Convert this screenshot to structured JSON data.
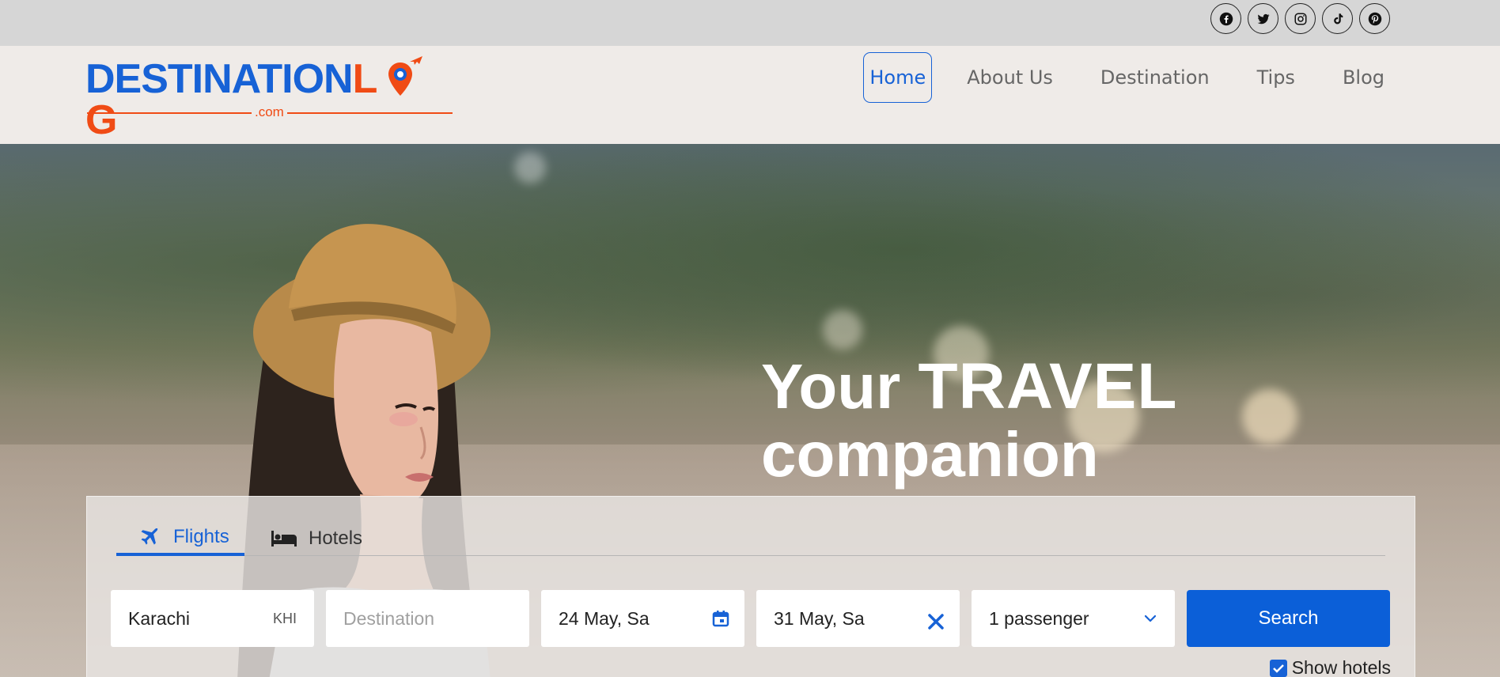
{
  "social": {
    "icons": [
      "facebook-icon",
      "twitter-icon",
      "instagram-icon",
      "tiktok-icon",
      "pinterest-icon"
    ]
  },
  "logo": {
    "part1": "DESTINATION",
    "part2": "L",
    "part3": "G",
    "dotcom": ".com",
    "colors": {
      "blue": "#1762d6",
      "orange": "#f04b15"
    }
  },
  "nav": {
    "items": [
      "Home",
      "About Us",
      "Destination",
      "Tips",
      "Blog"
    ],
    "active": "Home"
  },
  "hero": {
    "headline_your": "Your",
    "headline_travel": "TRAVEL",
    "headline_companion": "companion"
  },
  "search": {
    "tabs": [
      {
        "label": "Flights",
        "icon": "airplane-icon",
        "active": true
      },
      {
        "label": "Hotels",
        "icon": "bed-icon",
        "active": false
      }
    ],
    "origin": {
      "value": "Karachi",
      "code": "KHI"
    },
    "destination": {
      "placeholder": "Destination"
    },
    "depart": {
      "value": "24 May, Sa",
      "icon": "calendar-icon"
    },
    "return": {
      "value": "31 May, Sa",
      "icon": "close-icon"
    },
    "passengers": {
      "value": "1 passenger",
      "icon": "chevron-down-icon"
    },
    "button_label": "Search",
    "show_hotels": {
      "label": "Show hotels",
      "checked": true
    },
    "accent": "#0b5fd8"
  }
}
